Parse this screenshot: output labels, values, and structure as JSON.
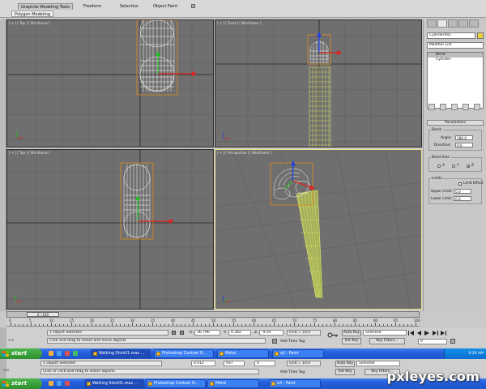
{
  "ribbon": {
    "tabs": [
      "Graphite Modeling Tools",
      "Freeform",
      "Selection",
      "Object Paint"
    ],
    "sub_tab": "Polygon Modeling"
  },
  "viewports": {
    "top_left": "[ + ] [ Top ] [ Wireframe ]",
    "top_right": "[ + ] [ Front ] [ Wireframe ]",
    "bottom_left": "[ + ] [ Top ] [ Wireframe ]",
    "bottom_right": "[ + ] [ Perspective ] [ Wireframe ]"
  },
  "command_panel": {
    "object_name": "Cylinder001",
    "modifier_list": "Modifier List",
    "stack": [
      "Bend",
      "Cylinder"
    ],
    "rollout_title": "Parameters",
    "bend_group": "Bend:",
    "angle_label": "Angle:",
    "angle_value": "180.0",
    "direction_label": "Direction:",
    "direction_value": "0.0",
    "axis_group": "Bend Axis:",
    "axis_x": "X",
    "axis_y": "Y",
    "axis_z": "Z",
    "limits_group": "Limits",
    "limit_effect": "Limit Effect",
    "upper_label": "Upper Limit:",
    "upper_value": "0.0",
    "lower_label": "Lower Limit:",
    "lower_value": "0.0"
  },
  "timeline": {
    "slider_label": "0 / 100",
    "ticks": [
      "0",
      "5",
      "10",
      "15",
      "20",
      "25",
      "30",
      "35",
      "40",
      "45",
      "50",
      "55",
      "60",
      "65",
      "70",
      "75",
      "80",
      "85",
      "90",
      "95",
      "100"
    ]
  },
  "status": {
    "selected": "1 Object Selected",
    "hint": "Click and drag to select and move objects",
    "x_label": "X:",
    "x_value": "36.796",
    "y_label": "Y:",
    "y_value": "0.382",
    "z_label": "Z:",
    "z_value": "-4.05",
    "grid": "Grid = 10.0",
    "add_time_tag": "Add Time Tag",
    "auto_key": "Auto Key",
    "set_key": "Set Key",
    "selected_dropdown": "Selected",
    "key_filters": "Key Filters...",
    "frame": "0",
    "left_label": "<<"
  },
  "status2": {
    "selected": "1 Object Selected",
    "hint": "Click or click-and-drag to select objects",
    "x_value": "0.012",
    "y_value": "937",
    "z_value": "0",
    "grid": "Grid = 10.0",
    "add_time_tag": "Add Time Tag",
    "auto_key": "Auto Key",
    "set_key": "Set Key",
    "selected_dropdown": "Selected",
    "key_filters": "Key Filters...",
    "left_label": "<<"
  },
  "taskbar1": {
    "start": "start",
    "items": [
      "Walking Stick01.max ...",
      "Photoshop Contest O...",
      "Metal",
      "a2 - Paint"
    ],
    "clock": "6:29 AM"
  },
  "taskbar2": {
    "start": "start",
    "items": [
      "Walking Stick01.max ...",
      "Photoshop Contest O...",
      "Metal",
      "a3 - Paint"
    ]
  },
  "watermark": "pxleyes.com",
  "colors": {
    "viewport_bg": "#6f6f6f",
    "wire": "#ffffff",
    "selected_wire": "#e7f06a",
    "bbox": "#e08a20",
    "axis_x": "#e02020",
    "axis_y": "#20c020",
    "axis_z": "#2040e0",
    "taskbar": "#245edb",
    "start": "#2f8f2f"
  }
}
